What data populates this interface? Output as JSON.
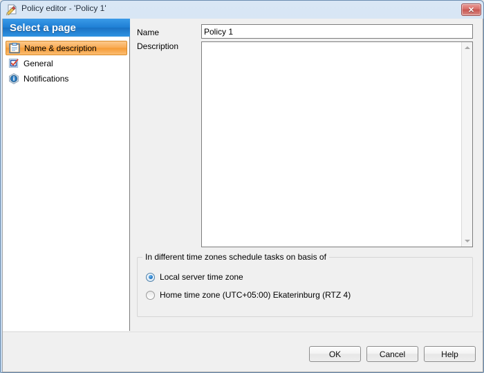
{
  "window": {
    "title": "Policy editor - 'Policy 1'",
    "title_icon": "document-pencil-icon",
    "close_label": "✕",
    "accent_blue": "#1e7fd4",
    "selection_orange": "#f59b35",
    "close_red": "#c75550"
  },
  "sidebar": {
    "header": "Select a page",
    "items": [
      {
        "label": "Name & description",
        "icon": "clipboard-icon",
        "selected": true
      },
      {
        "label": "General",
        "icon": "checkbox-checked-icon",
        "selected": false
      },
      {
        "label": "Notifications",
        "icon": "info-icon",
        "selected": false
      }
    ]
  },
  "form": {
    "name_label": "Name",
    "name_value": "Policy 1",
    "name_placeholder": "",
    "description_label": "Description",
    "description_value": "",
    "description_placeholder": ""
  },
  "timezone_group": {
    "title": "In different time zones schedule tasks on basis of",
    "options": [
      {
        "label": "Local server time zone",
        "checked": true
      },
      {
        "label": "Home time zone (UTC+05:00) Ekaterinburg (RTZ 4)",
        "checked": false
      }
    ]
  },
  "footer": {
    "ok_label": "OK",
    "cancel_label": "Cancel",
    "help_label": "Help"
  }
}
